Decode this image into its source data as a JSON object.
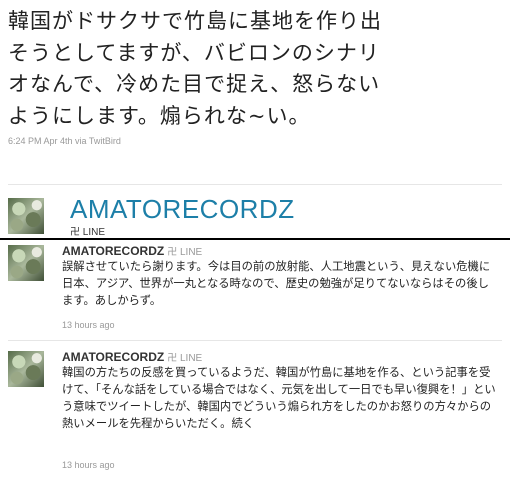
{
  "top_tweet": {
    "text": "韓国がドサクサで竹島に基地を作り出\nそうとしてますが、バビロンのシナリ\nオなんで、冷めた目で捉え、怒らない\nようにします。煽られな~い。",
    "meta": "6:24 PM Apr 4th via TwitBird"
  },
  "profile": {
    "name": "AMATORECORDZ",
    "sub": "卍 LINE"
  },
  "tweets": [
    {
      "user": "AMATORECORDZ",
      "line": "卍 LINE",
      "body": "誤解させていたら謝ります。今は目の前の放射能、人工地震という、見えない危機に日本、アジア、世界が一丸となる時なので、歴史の勉強が足りてないならはその後します。あしからず。",
      "time": "13 hours ago"
    },
    {
      "user": "AMATORECORDZ",
      "line": "卍 LINE",
      "body": "韓国の方たちの反感を買っているようだ、韓国が竹島に基地を作る、という記事を受けて、「そんな話をしている場合ではなく、元気を出して一日でも早い復興を！」という意味でツイートしたが、韓国内でどういう煽られ方をしたのかお怒りの方々からの熱いメールを先程からいただく。続く",
      "time": "13 hours ago"
    }
  ]
}
